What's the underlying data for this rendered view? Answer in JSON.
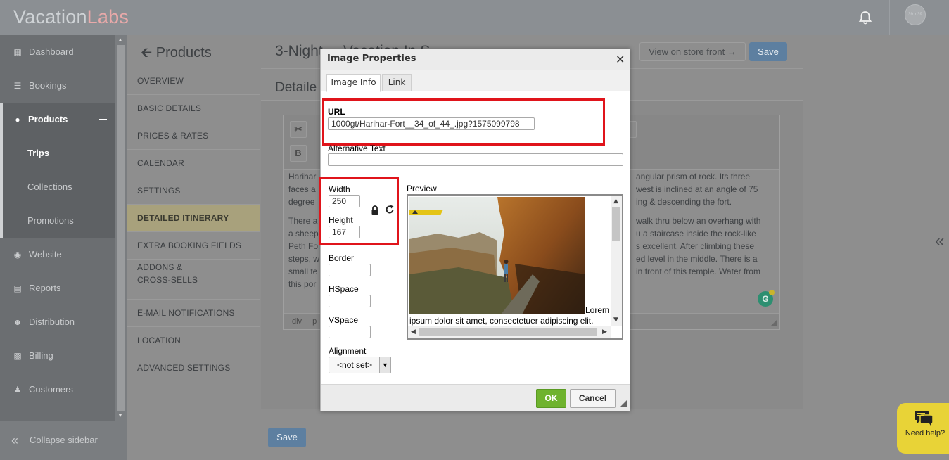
{
  "app": {
    "logo_part1": "Vacation",
    "logo_part2": "Labs",
    "avatar_initials": "39 x 39"
  },
  "sidebar": {
    "items": [
      {
        "label": "Dashboard",
        "icon": "dashboard-icon"
      },
      {
        "label": "Bookings",
        "icon": "list-icon"
      },
      {
        "label": "Products",
        "icon": "map-marker-icon"
      },
      {
        "label": "Trips"
      },
      {
        "label": "Collections"
      },
      {
        "label": "Promotions"
      },
      {
        "label": "Website",
        "icon": "globe-icon"
      },
      {
        "label": "Reports",
        "icon": "report-icon"
      },
      {
        "label": "Distribution",
        "icon": "users-icon"
      },
      {
        "label": "Billing",
        "icon": "money-icon"
      },
      {
        "label": "Customers",
        "icon": "user-icon"
      }
    ],
    "collapse_label": "Collapse sidebar"
  },
  "product_nav": {
    "back_title": "Products",
    "items": [
      "OVERVIEW",
      "BASIC DETAILS",
      "PRICES & RATES",
      "CALENDAR",
      "SETTINGS",
      "DETAILED ITINERARY",
      "EXTRA BOOKING FIELDS",
      "ADDONS & CROSS-SELLS",
      "E-MAIL NOTIFICATIONS",
      "LOCATION",
      "ADVANCED SETTINGS"
    ],
    "active_item": "DETAILED ITINERARY"
  },
  "main": {
    "page_title": "3-Nigh",
    "page_title_tail": "t ... Vacation In S...",
    "view_store_label": "View on store front →",
    "save_label": "Save",
    "section_title": "Detaile",
    "editor_paragraph1_left": "Harihar\nfaces a\ndegree",
    "editor_paragraph1_right": "angular prism of rock. Its three\nwest is inclined at an angle of 75\ning & descending the fort.",
    "editor_paragraph2_left": "There a\na sheep\nPeth Fo\nsteps, w\nsmall te\nthis por",
    "editor_paragraph2_right": "walk thru below an overhang with\nu a staircase inside the rock-like\ns excellent. After climbing these\ned level in the middle. There is a\nin front of this temple. Water from",
    "editor_status": "div p",
    "save_bottom_label": "Save"
  },
  "dialog": {
    "title": "Image Properties",
    "tabs": [
      "Image Info",
      "Link"
    ],
    "url_label": "URL",
    "url_value": "1000gt/Harihar-Fort__34_of_44_.jpg?1575099798",
    "alt_label": "Alternative Text",
    "alt_value": "",
    "width_label": "Width",
    "width_value": "250",
    "height_label": "Height",
    "height_value": "167",
    "border_label": "Border",
    "hspace_label": "HSpace",
    "vspace_label": "VSpace",
    "alignment_label": "Alignment",
    "alignment_value": "<not set>",
    "preview_label": "Preview",
    "preview_text_1": "Lorem",
    "preview_text_2": "ipsum dolor sit amet, consectetuer adipiscing elit.",
    "ok_label": "OK",
    "cancel_label": "Cancel"
  },
  "help": {
    "label": "Need help?"
  },
  "colors": {
    "highlight_red": "#e0141b",
    "ok_green": "#6fb32e",
    "save_blue": "#5d7fa0",
    "help_yellow": "#e8d337"
  }
}
